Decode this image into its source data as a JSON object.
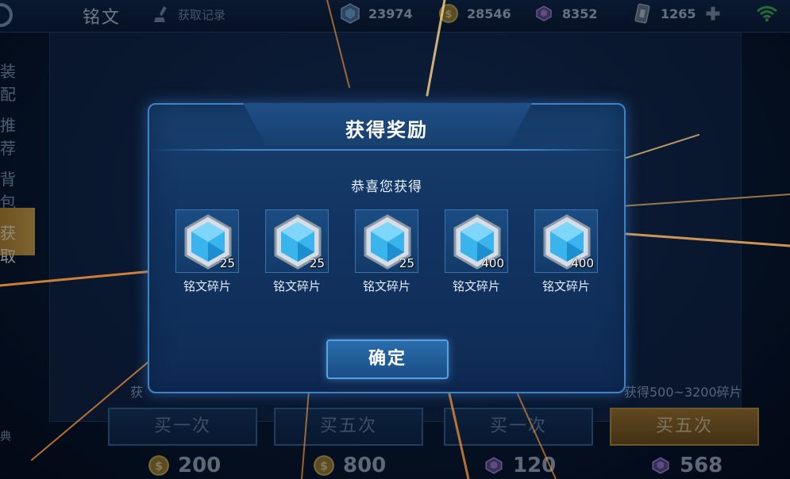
{
  "topbar": {
    "title": "铭文",
    "history_label": "获取记录",
    "resources": [
      {
        "icon": "diamond-icon",
        "value": "23974"
      },
      {
        "icon": "gold-coin-icon",
        "value": "28546"
      },
      {
        "icon": "purple-crystal-icon",
        "value": "8352"
      },
      {
        "icon": "coupon-icon",
        "value": "1265"
      }
    ]
  },
  "sidebar": {
    "items": [
      {
        "label": "装配"
      },
      {
        "label": "推荐"
      },
      {
        "label": "背包"
      },
      {
        "label": "获取"
      }
    ],
    "bottom_label": "典"
  },
  "shop": {
    "hint_left": "获",
    "hint_right": "获得500~3200碎片",
    "buttons": [
      {
        "label": "买一次"
      },
      {
        "label": "买五次"
      },
      {
        "label": "买一次"
      },
      {
        "label": "买五次"
      }
    ],
    "prices": [
      {
        "icon": "gold-coin-icon",
        "value": "200"
      },
      {
        "icon": "gold-coin-icon",
        "value": "800"
      },
      {
        "icon": "purple-crystal-icon",
        "value": "120"
      },
      {
        "icon": "purple-crystal-icon",
        "value": "568"
      }
    ]
  },
  "modal": {
    "title": "获得奖励",
    "subtitle": "恭喜您获得",
    "rewards": [
      {
        "name": "铭文碎片",
        "count": "25"
      },
      {
        "name": "铭文碎片",
        "count": "25"
      },
      {
        "name": "铭文碎片",
        "count": "25"
      },
      {
        "name": "铭文碎片",
        "count": "400"
      },
      {
        "name": "铭文碎片",
        "count": "400"
      }
    ],
    "confirm_label": "确定"
  },
  "colors": {
    "accent_blue": "#3f83c6",
    "gold": "#e6b24c",
    "ray": "#ff9a3c"
  }
}
